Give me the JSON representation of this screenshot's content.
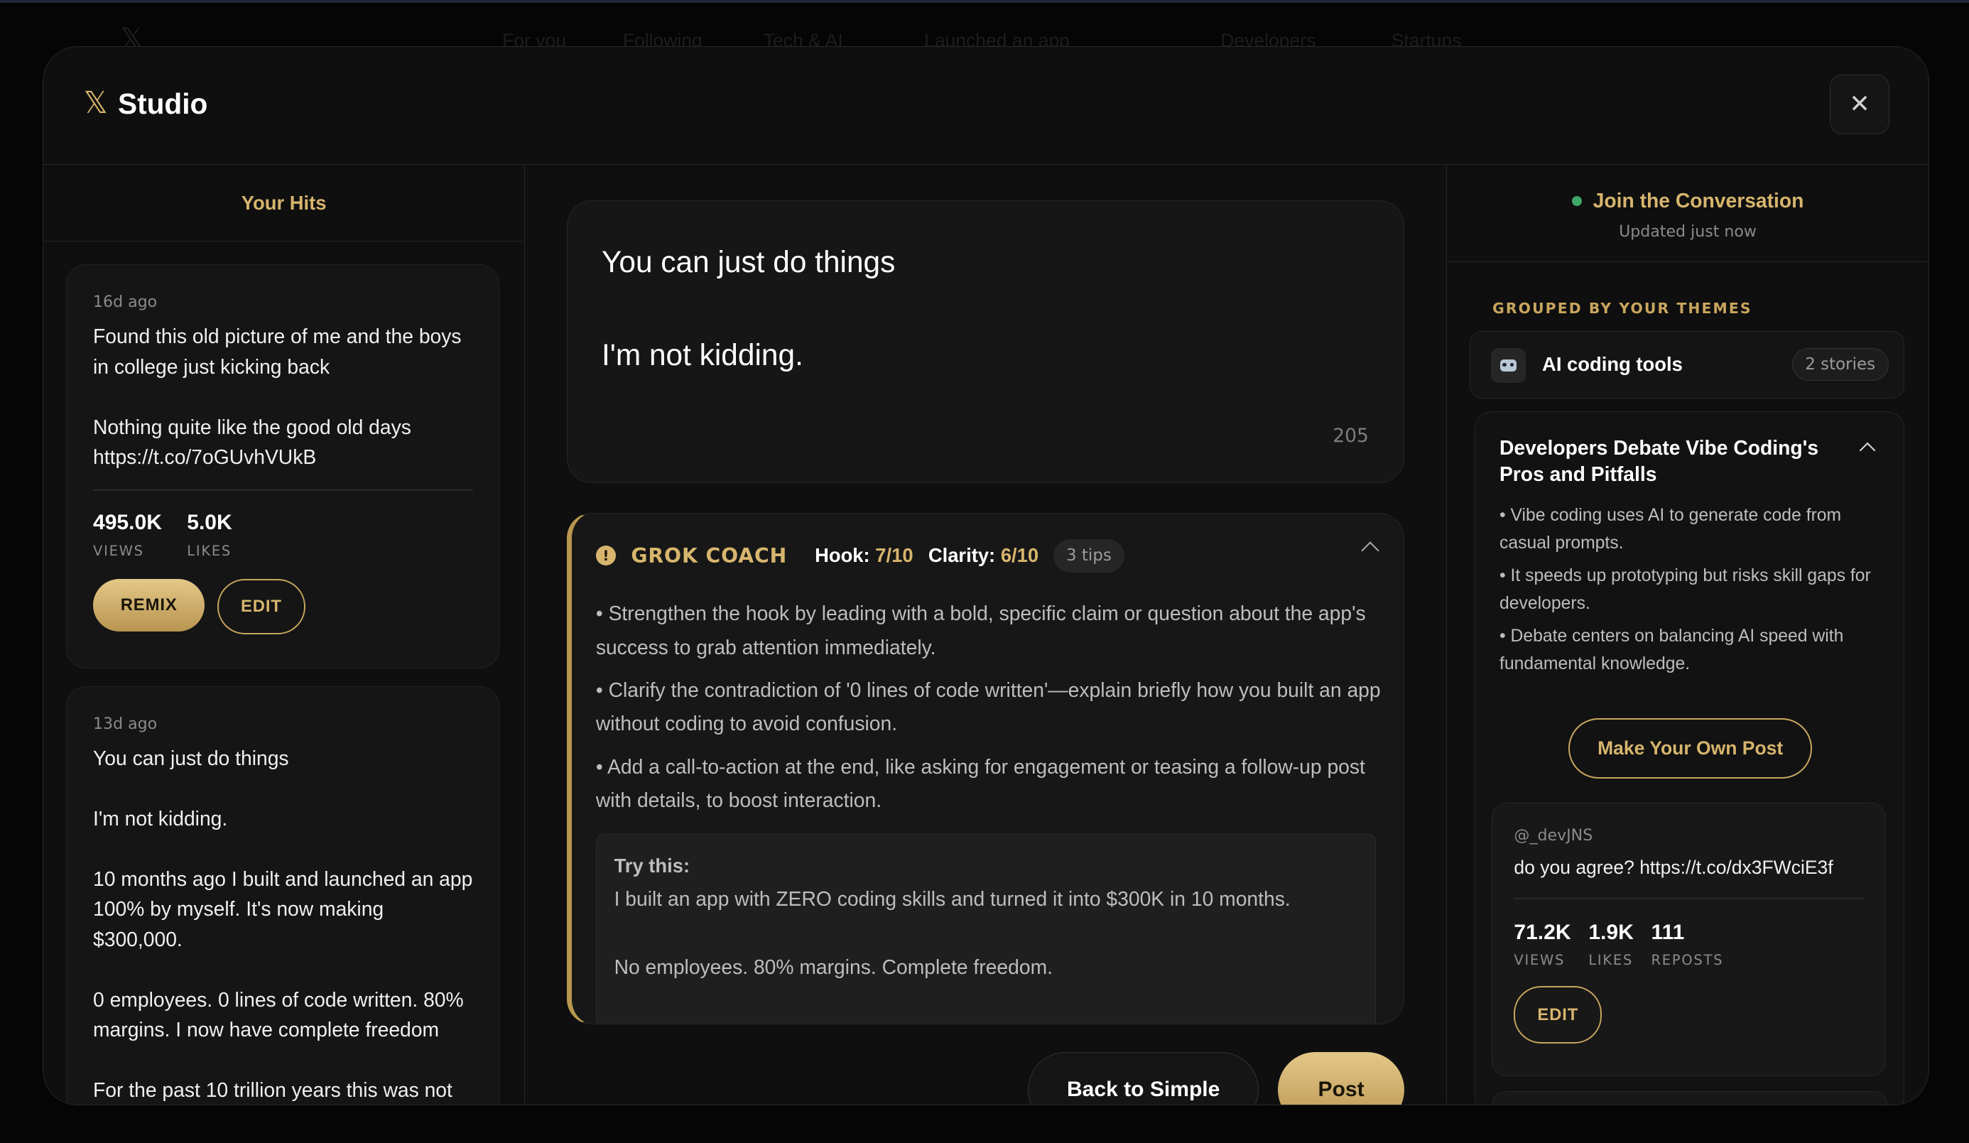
{
  "background": {
    "logo": "𝕏",
    "tabs": [
      "For you",
      "Following",
      "Tech & AI",
      "Launched an app",
      "Developers",
      "Startups"
    ]
  },
  "modal": {
    "brand_mark": "𝕏",
    "title": "Studio",
    "close_icon": "✕"
  },
  "hits": {
    "header": "Your Hits",
    "items": [
      {
        "age": "16d ago",
        "text": "Found this old picture of me and the boys in college just kicking back\n\nNothing quite like the good old days https://t.co/7oGUvhVUkB",
        "views": "495.0K",
        "views_label": "VIEWS",
        "likes": "5.0K",
        "likes_label": "LIKES",
        "remix_label": "REMIX",
        "edit_label": "EDIT"
      },
      {
        "age": "13d ago",
        "text": "You can just do things\n\nI'm not kidding.\n\n10 months ago I built and launched an app 100% by myself. It's now making $300,000.\n\n0 employees. 0 lines of code written. 80% margins. I now have complete freedom\n\nFor the past 10 trillion years this was not"
      }
    ]
  },
  "composer": {
    "text": "You can just do things\n\nI'm not kidding.",
    "char_count": "205"
  },
  "coach": {
    "title": "GROK COACH",
    "hook_label": "Hook:",
    "hook_value": "7/10",
    "clarity_label": "Clarity:",
    "clarity_value": "6/10",
    "tips_count": "3 tips",
    "warn_icon": "!",
    "tips": [
      "• Strengthen the hook by leading with a bold, specific claim or question about the app's success to grab attention immediately.",
      "• Clarify the contradiction of '0 lines of code written'—explain briefly how you built an app without coding to avoid confusion.",
      "• Add a call-to-action at the end, like asking for engagement or teasing a follow-up post with details, to boost interaction."
    ],
    "try_title": "Try this:",
    "try_text": "I built an app with ZERO coding skills and turned it into $300K in 10 months.\n\nNo employees. 80% margins. Complete freedom."
  },
  "actions": {
    "back_label": "Back to Simple",
    "post_label": "Post"
  },
  "conversation": {
    "title": "Join the Conversation",
    "updated": "Updated just now",
    "status_color": "#3fa667",
    "themes_label": "GROUPED BY YOUR THEMES",
    "theme": {
      "icon": "robot-icon",
      "name": "AI coding tools",
      "count": "2 stories"
    },
    "story": {
      "title": "Developers Debate Vibe Coding's Pros and Pitfalls",
      "bullets": [
        "• Vibe coding uses AI to generate code from casual prompts.",
        "• It speeds up prototyping but risks skill gaps for developers.",
        "• Debate centers on balancing AI speed with fundamental knowledge."
      ],
      "cta_label": "Make Your Own Post",
      "tweet": {
        "handle": "@_devJNS",
        "text": "do you agree? https://t.co/dx3FWciE3f",
        "views": "71.2K",
        "views_label": "VIEWS",
        "likes": "1.9K",
        "likes_label": "LIKES",
        "reposts": "111",
        "reposts_label": "REPOSTS",
        "edit_label": "EDIT"
      }
    }
  },
  "colors": {
    "accent": "#d7b56d",
    "background": "#0f0f0f",
    "card": "#151515"
  }
}
